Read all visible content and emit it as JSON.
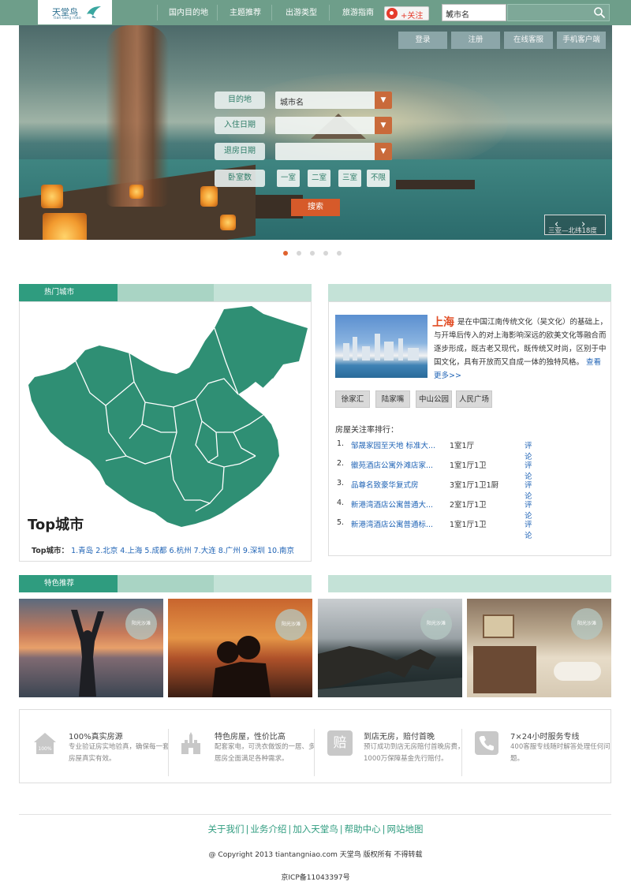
{
  "brand": {
    "name": "天堂鸟",
    "sub": "tian tang niao"
  },
  "nav": {
    "items": [
      {
        "label": "国内目的地"
      },
      {
        "label": "主题推荐"
      },
      {
        "label": "出游类型"
      },
      {
        "label": "旅游指南"
      }
    ],
    "follow_label": "+关注",
    "city_select": "城市名",
    "search_placeholder": ""
  },
  "hero_buttons": {
    "login": "登录",
    "register": "注册",
    "service": "在线客服",
    "mobile": "手机客户端"
  },
  "search_form": {
    "destination_label": "目的地",
    "destination_value": "城市名",
    "checkin_label": "入住日期",
    "checkin_value": "",
    "checkout_label": "退房日期",
    "checkout_value": "",
    "rooms_label": "卧室数",
    "room_options": [
      "一室",
      "二室",
      "三室",
      "不限"
    ],
    "submit": "搜索"
  },
  "hero_route": {
    "prev_icon": "chevron-left-icon",
    "next_icon": "chevron-right-icon",
    "text": "三亚—北纬18度"
  },
  "carousel": {
    "count": 5,
    "active": 0
  },
  "hot_cities": {
    "tab_label": "热门城市",
    "title": "Top城市",
    "list_label": "Top城市：",
    "cities": [
      "1.青岛",
      "2.北京",
      "4.上海",
      "5.成都",
      "6.杭州",
      "7.大连",
      "8.广州",
      "9.深圳",
      "10.南京"
    ]
  },
  "city_info": {
    "title": "上海",
    "description": "是在中国江南传统文化（吴文化）的基础上，与开埠后传入的对上海影响深远的欧美文化等融合而逐步形成，既古老又现代，既传统又时尚，区别于中国文化，具有开放而又自成一体的独特风格。",
    "more_link": "查看更多>>",
    "tags": [
      "徐家汇",
      "陆家嘴",
      "中山公园",
      "人民广场"
    ],
    "rank_title": "房屋关注率排行：",
    "rankings": [
      {
        "no": "1.",
        "name": "邹晟家园至天地 标准大...",
        "type": "1室1厅",
        "action": "评论"
      },
      {
        "no": "2.",
        "name": "徽苑酒店公寓外滩店家...",
        "type": "1室1厅1卫",
        "action": "评论"
      },
      {
        "no": "3.",
        "name": "品尊名致豪华复式房",
        "type": "3室1厅1卫1厨",
        "action": "评论"
      },
      {
        "no": "4.",
        "name": "新港湾酒店公寓普通大...",
        "type": "2室1厅1卫",
        "action": "评论"
      },
      {
        "no": "5.",
        "name": "新港湾酒店公寓普通标...",
        "type": "1室1厅1卫",
        "action": "评论"
      }
    ]
  },
  "featured": {
    "tab_label": "特色推荐",
    "badge": "阳光沙滩"
  },
  "guarantees": [
    {
      "icon": "house-icon",
      "title": "100%真实房源",
      "desc": "专业验证房实地验真，确保每一套房屋真实有效。"
    },
    {
      "icon": "castle-icon",
      "title": "特色房屋，性价比高",
      "desc": "配套家电，可洗衣做饭的一居、多居房全面满足各种需求。"
    },
    {
      "icon": "compensation-icon",
      "glyph": "赔",
      "title": "到店无房，赔付首晚",
      "desc": "预订成功到店无房赔付首晚房费，1000万保障基金先行赔付。"
    },
    {
      "icon": "phone-icon",
      "title": "7×24小时服务专线",
      "desc": "400客服专线随时解答处理任何问题。"
    }
  ],
  "footer": {
    "links": [
      "关于我们",
      "业务介绍",
      "加入天堂鸟",
      "帮助中心",
      "网站地图"
    ],
    "copyright": "@ Copyright 2013 tiantangniao.com 天堂鸟 版权所有 不得转载",
    "icp": "京ICP备11043397号"
  },
  "colors": {
    "nav_bg": "#6e9e8a",
    "accent_green": "#2f9c7f",
    "accent_orange": "#d65a2a",
    "link_blue": "#1f63b5",
    "title_red": "#e24d25"
  }
}
